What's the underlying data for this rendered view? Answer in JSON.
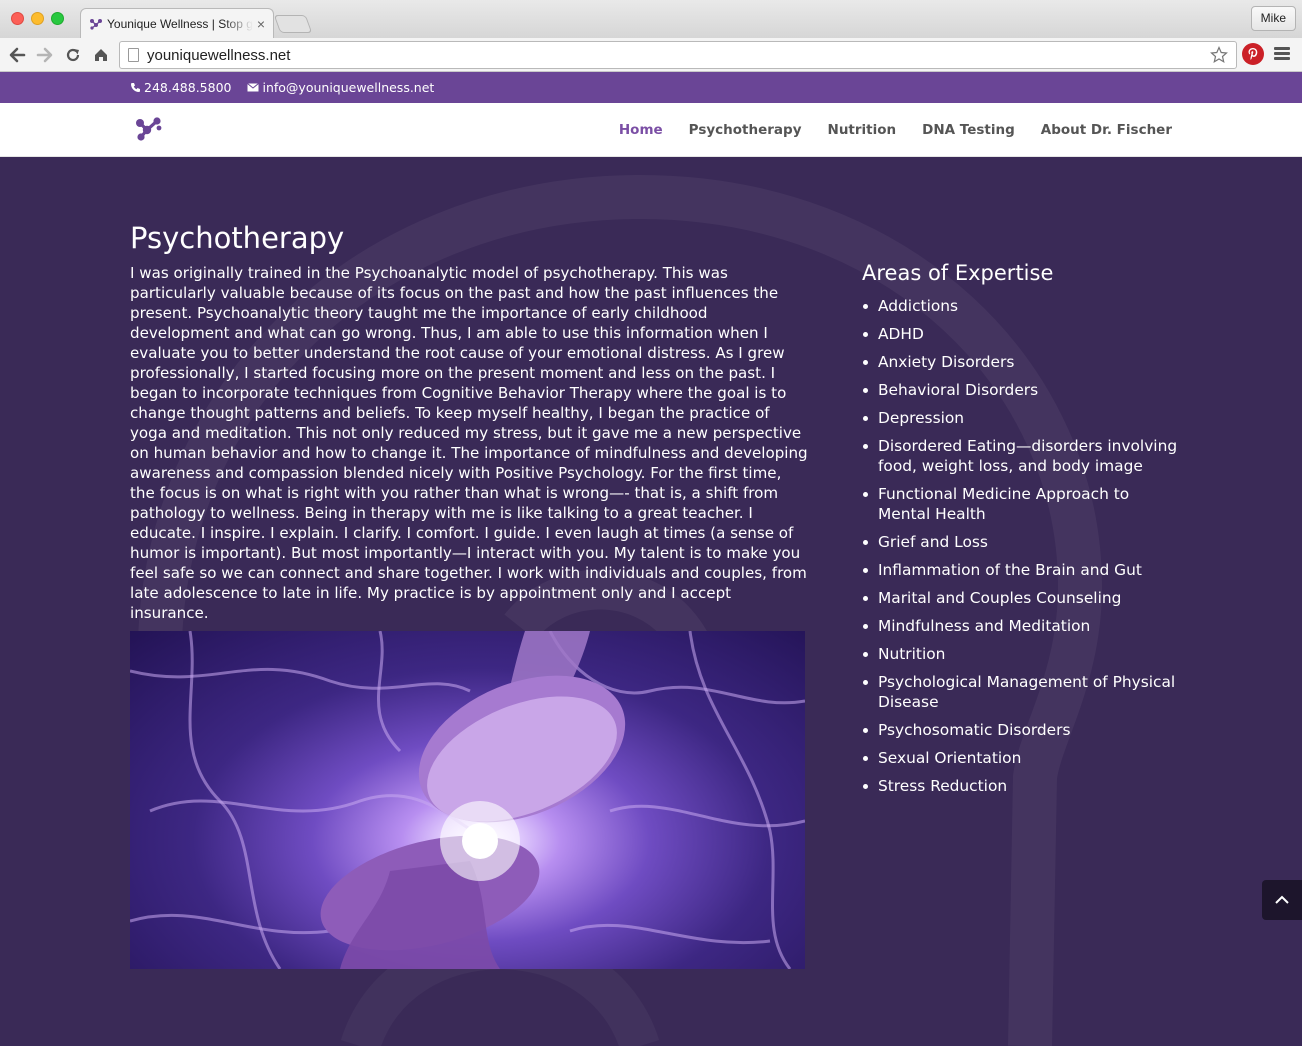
{
  "browser": {
    "tab_title": "Younique Wellness | Stop g",
    "tab_close": "×",
    "profile_name": "Mike",
    "url": "youniquewellness.net"
  },
  "site": {
    "phone": "248.488.5800",
    "email": "info@youniquewellness.net",
    "nav": {
      "home": "Home",
      "psychotherapy": "Psychotherapy",
      "nutrition": "Nutrition",
      "dna": "DNA Testing",
      "about": "About Dr. Fischer"
    },
    "accent_color": "#6a4596",
    "background_color": "#3a2a57"
  },
  "content": {
    "title": "Psychotherapy",
    "intro": "I was originally trained in the Psychoanalytic model of psychotherapy. This was particularly valuable because of its focus on the past and how the past influences the present. Psychoanalytic theory taught me the importance of early childhood development and what can go wrong. Thus, I am able to use this information when I evaluate you to better understand the root cause of your emotional distress. As I grew professionally, I started focusing more on the present moment and less on the past. I began to incorporate techniques from Cognitive Behavior Therapy where the goal is to change thought patterns and beliefs. To keep myself healthy, I began the practice of yoga and meditation. This not only reduced my stress, but it gave me a new perspective on human behavior and how to change it. The importance of mindfulness and developing awareness and compassion blended nicely with Positive Psychology. For the first time, the focus is on what is right with you rather than what is wrong—- that is, a shift from pathology to wellness. Being in therapy with me is like talking to a great teacher. I educate. I inspire. I explain. I clarify. I comfort. I guide. I even laugh at times (a sense of humor is important). But most importantly—I interact with you. My talent is to make you feel safe so we can connect and share together. I work with individuals and couples, from late adolescence to late in life. My practice is by appointment only and I accept insurance."
  },
  "sidebar": {
    "title": "Areas of Expertise",
    "items": [
      "Addictions",
      "ADHD",
      "Anxiety Disorders",
      "Behavioral Disorders",
      "Depression",
      "Disordered Eating—disorders involving food, weight loss, and body image",
      "Functional Medicine Approach to Mental Health",
      "Grief and Loss",
      "Inflammation of the Brain and Gut",
      "Marital and Couples Counseling",
      "Mindfulness and Meditation",
      "Nutrition",
      "Psychological Management of Physical Disease",
      "Psychosomatic Disorders",
      "Sexual Orientation",
      "Stress Reduction"
    ]
  },
  "icons": {
    "back": "back-arrow-icon",
    "forward": "forward-arrow-icon",
    "reload": "reload-icon",
    "home": "home-icon",
    "bookmark": "star-icon",
    "extension": "pinterest-icon",
    "menu": "hamburger-menu-icon",
    "phone": "phone-icon",
    "email": "envelope-icon",
    "scroll_top": "chevron-up-icon"
  }
}
